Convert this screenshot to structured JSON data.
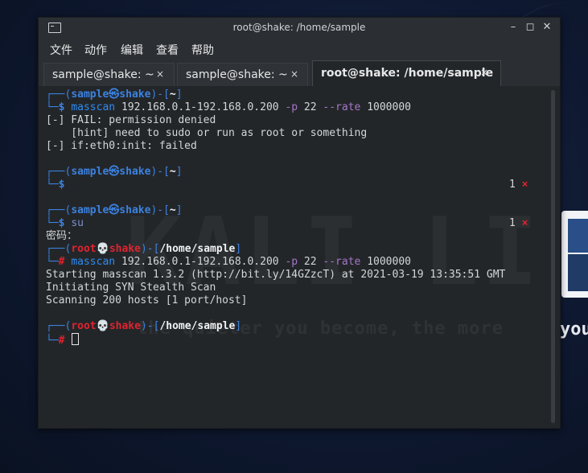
{
  "window": {
    "title": "root@shake: /home/sample"
  },
  "menu": [
    "文件",
    "动作",
    "编辑",
    "查看",
    "帮助"
  ],
  "tabs": [
    {
      "label": "sample@shake: ~",
      "close": "×"
    },
    {
      "label": "sample@shake: ~",
      "close": "×"
    },
    {
      "label": "root@shake: /home/sample",
      "close": "×"
    }
  ],
  "wallpaper": {
    "tagline_tail": "you"
  },
  "watermark": {
    "big": "KALI LI",
    "tagline": "the quieter you become, the more"
  },
  "prompt": {
    "top": "┌──(",
    "close": ")-[",
    "end": "]",
    "bottom": "└─",
    "user_sample": "sample",
    "user_root": "root",
    "sep_sample": "㉿",
    "sep_root": "💀",
    "host": "shake",
    "dir_home": "~",
    "dir_sample": "/home/sample",
    "sym_user": "$",
    "sym_root": "#"
  },
  "session": {
    "cmd1": {
      "bin": "masscan",
      "range": "192.168.0.1-192.168.0.200",
      "opt_p": "-p",
      "port": "22",
      "opt_rate": "--rate",
      "rate": "1000000"
    },
    "out1": [
      "[-] FAIL: permission denied",
      "    [hint] need to sudo or run as root or something",
      "[-] if:eth0:init: failed"
    ],
    "status_num": "1",
    "status_x": "×",
    "cmd_su": "su",
    "password_prompt": "密码：",
    "out2": [
      "Starting masscan 1.3.2 (http://bit.ly/14GZzcT) at 2021-03-19 13:35:51 GMT",
      "Initiating SYN Stealth Scan",
      "Scanning 200 hosts [1 port/host]"
    ]
  },
  "colors": {
    "user_blue": "#3b82e0",
    "root_red": "#e0232e",
    "background": "#232629"
  }
}
